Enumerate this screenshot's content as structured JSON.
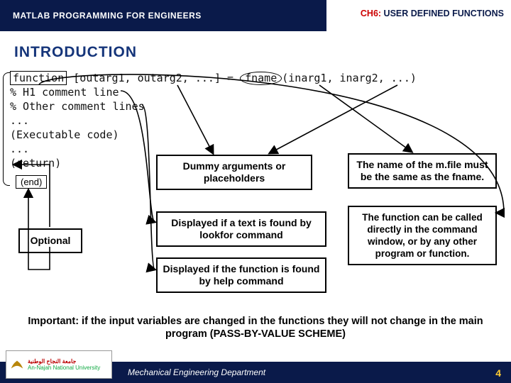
{
  "header": {
    "left": "MATLAB PROGRAMMING FOR ENGINEERS",
    "chapter_tag": "CH6:",
    "chapter_title": "USER DEFINED FUNCTIONS"
  },
  "section_title": "INTRODUCTION",
  "code": {
    "kw_function": "function",
    "outargs": "[outarg1, outarg2, ...]",
    "equals": " = ",
    "fname": "fname",
    "inargs": "(inarg1, inarg2, ...)",
    "line2": "% H1 comment line",
    "line3": "% Other comment lines",
    "line4": "...",
    "line5": "(Executable code)",
    "line6": "...",
    "line7": "(return)",
    "end_label": "(end)"
  },
  "boxes": {
    "dummy": "Dummy arguments or placeholders",
    "mfile": "The name of the m.file must be the same as the fname.",
    "lookfor": "Displayed if a text is found by lookfor command",
    "help": "Displayed if the function is found by help command",
    "callable": "The function can be called directly in the command window, or by any other program or function.",
    "optional": "Optional"
  },
  "important": "Important: if the input variables are changed in the functions they will not change in the main program (PASS-BY-VALUE SCHEME)",
  "footer": {
    "dept": "Mechanical Engineering Department",
    "uni_en": "An-Najah National University",
    "uni_ar": "جامعة النجاح الوطنية",
    "slide_num": "4"
  }
}
